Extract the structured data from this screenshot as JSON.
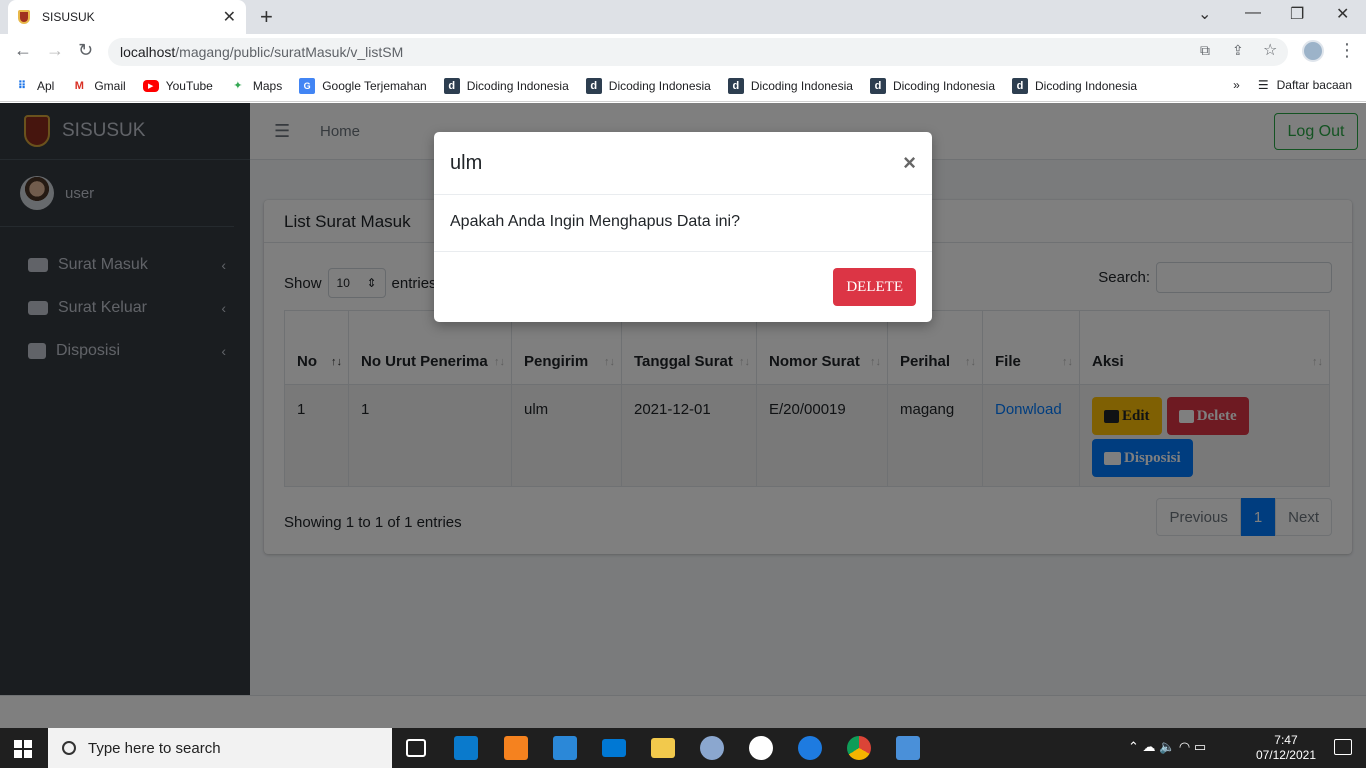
{
  "browser": {
    "tab_title": "SISUSUK",
    "url_host": "localhost",
    "url_path": "/magang/public/suratMasuk/v_listSM",
    "bookmarks": [
      "Apl",
      "Gmail",
      "YouTube",
      "Maps",
      "Google Terjemahan",
      "Dicoding Indonesia",
      "Dicoding Indonesia",
      "Dicoding Indonesia",
      "Dicoding Indonesia",
      "Dicoding Indonesia"
    ],
    "reading_list": "Daftar bacaan"
  },
  "sidebar": {
    "brand": "SISUSUK",
    "user": "user",
    "items": [
      {
        "label": "Surat Masuk"
      },
      {
        "label": "Surat Keluar"
      },
      {
        "label": "Disposisi"
      }
    ]
  },
  "topnav": {
    "home": "Home",
    "logout": "Log Out"
  },
  "card": {
    "title": "List Surat Masuk",
    "show_label": "Show",
    "entries_label": "entries",
    "length_value": "10",
    "search_label": "Search:",
    "columns": [
      "No",
      "No Urut Penerima",
      "Pengirim",
      "Tanggal Surat",
      "Nomor Surat",
      "Perihal",
      "File",
      "Aksi"
    ],
    "rows": [
      {
        "no": "1",
        "no_urut": "1",
        "pengirim": "ulm",
        "tanggal": "2021-12-01",
        "nomor": "E/20/00019",
        "perihal": "magang",
        "file": "Donwload",
        "actions": {
          "edit": "Edit",
          "delete": "Delete",
          "disposisi": "Disposisi"
        }
      }
    ],
    "info": "Showing 1 to 1 of 1 entries",
    "pager": {
      "prev": "Previous",
      "page": "1",
      "next": "Next"
    }
  },
  "modal": {
    "title": "ulm",
    "close": "×",
    "body": "Apakah Anda Ingin Menghapus Data ini?",
    "delete_button": "DELETE"
  },
  "taskbar": {
    "search_placeholder": "Type here to search",
    "time": "7:47",
    "date": "07/12/2021"
  }
}
